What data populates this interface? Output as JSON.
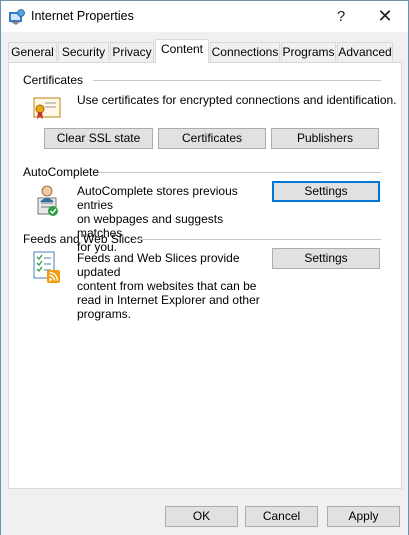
{
  "window": {
    "title": "Internet Properties"
  },
  "titlebar": {
    "help_label": "?",
    "close_label": "✕"
  },
  "tabs": [
    {
      "label": "General"
    },
    {
      "label": "Security"
    },
    {
      "label": "Privacy"
    },
    {
      "label": "Content",
      "active": true
    },
    {
      "label": "Connections"
    },
    {
      "label": "Programs"
    },
    {
      "label": "Advanced"
    }
  ],
  "certificates": {
    "title": "Certificates",
    "description": "Use certificates for encrypted connections and identification.",
    "buttons": {
      "clear_ssl": "Clear SSL state",
      "certificates": "Certificates",
      "publishers": "Publishers"
    }
  },
  "autocomplete": {
    "title": "AutoComplete",
    "description_lines": [
      "AutoComplete stores previous entries",
      "on webpages and suggests matches",
      "for you."
    ],
    "settings_label": "Settings"
  },
  "feeds": {
    "title": "Feeds and Web Slices",
    "description_lines": [
      "Feeds and Web Slices provide updated",
      "content from websites that can be",
      "read in Internet Explorer and other",
      "programs."
    ],
    "settings_label": "Settings"
  },
  "footer": {
    "ok": "OK",
    "cancel": "Cancel",
    "apply": "Apply"
  },
  "colors": {
    "focus_border": "#0078d7",
    "button_bg": "#e1e1e1",
    "rss_orange": "#f39c12"
  }
}
